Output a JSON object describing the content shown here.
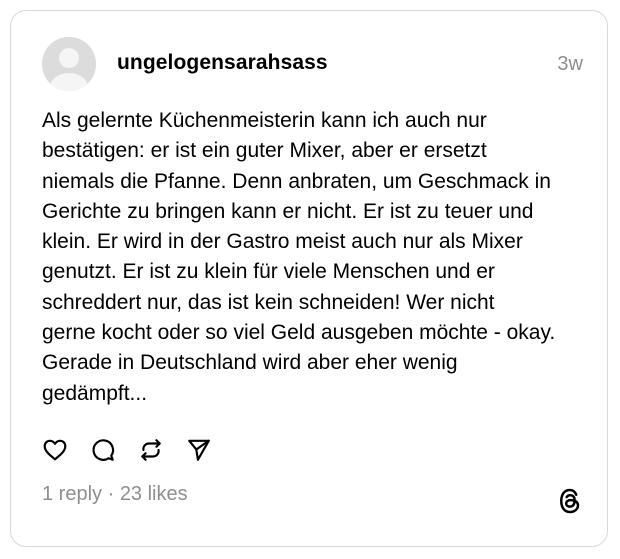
{
  "post": {
    "username": "ungelogensarahsass",
    "time": "3w",
    "text": "Als gelernte Küchenmeisterin kann ich auch nur\nbestätigen: er ist ein guter Mixer, aber er ersetzt\nniemals die Pfanne. Denn anbraten, um Geschmack in\nGerichte zu bringen kann er nicht. Er ist zu teuer und\nklein. Er wird in der Gastro meist auch nur als Mixer\ngenutzt. Er ist zu klein für viele Menschen und er\nschreddert nur, das ist kein schneiden! Wer nicht\ngerne kocht oder so viel Geld ausgeben möchte - okay.\nGerade in Deutschland wird aber eher wenig\ngedämpft...",
    "replies": "1 reply",
    "separator": " · ",
    "likes": "23 likes"
  },
  "icons": {
    "like": "heart-icon",
    "reply": "comment-icon",
    "repost": "repost-icon",
    "share": "send-icon",
    "brand": "threads-logo-icon"
  },
  "colors": {
    "border": "#d9d9d9",
    "muted_text": "#8e8e8e",
    "avatar_bg": "#dcdcdc"
  }
}
